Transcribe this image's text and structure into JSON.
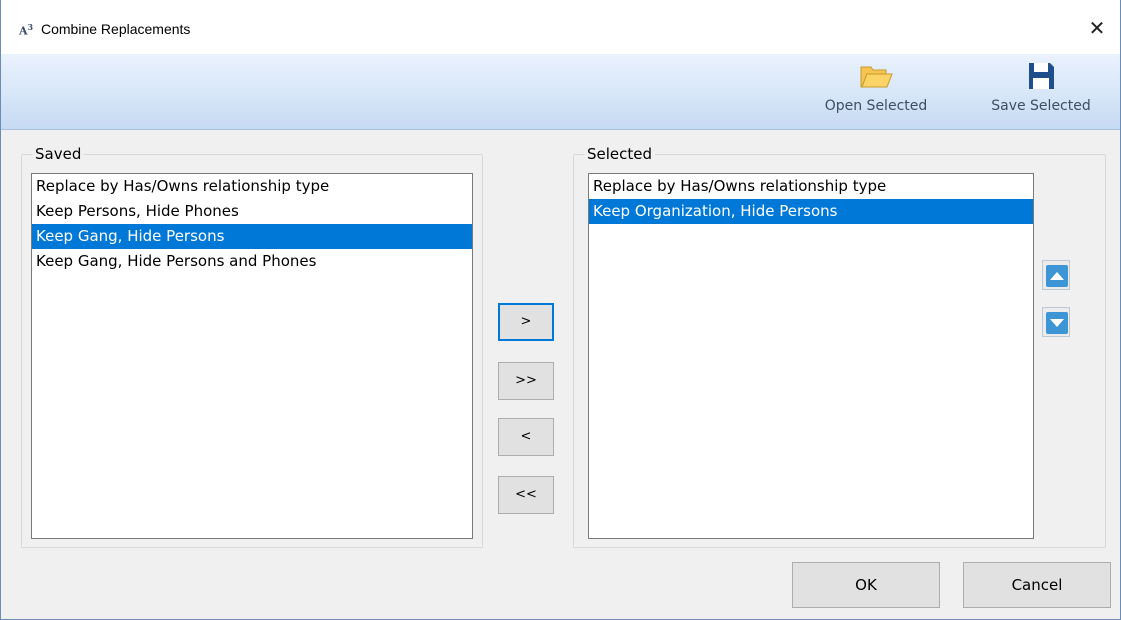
{
  "window": {
    "title": "Combine Replacements",
    "app_icon_text": "A",
    "app_icon_sup": "3",
    "close_glyph": "✕"
  },
  "toolbar": {
    "open_label": "Open Selected",
    "save_label": "Save Selected",
    "open_icon": "folder-open-icon",
    "save_icon": "floppy-disk-icon"
  },
  "saved": {
    "label": "Saved",
    "items": [
      {
        "text": "Replace by Has/Owns relationship type",
        "selected": false
      },
      {
        "text": "Keep Persons, Hide Phones",
        "selected": false
      },
      {
        "text": "Keep Gang, Hide Persons",
        "selected": true
      },
      {
        "text": "Keep Gang, Hide Persons and Phones",
        "selected": false
      }
    ]
  },
  "selected": {
    "label": "Selected",
    "items": [
      {
        "text": "Replace by Has/Owns relationship type",
        "selected": false
      },
      {
        "text": "Keep Organization, Hide Persons",
        "selected": true
      }
    ]
  },
  "move_buttons": {
    "add": ">",
    "add_all": ">>",
    "remove": "<",
    "remove_all": "<<"
  },
  "order_buttons": {
    "up_icon": "arrow-up-icon",
    "down_icon": "arrow-down-icon"
  },
  "dialog_buttons": {
    "ok": "OK",
    "cancel": "Cancel"
  },
  "colors": {
    "selection": "#0078d7",
    "toolbar_gradient_top": "#eaf2fd",
    "toolbar_gradient_bottom": "#c6daf3",
    "folder": "#f5c451",
    "save_icon": "#1e4f8c"
  }
}
